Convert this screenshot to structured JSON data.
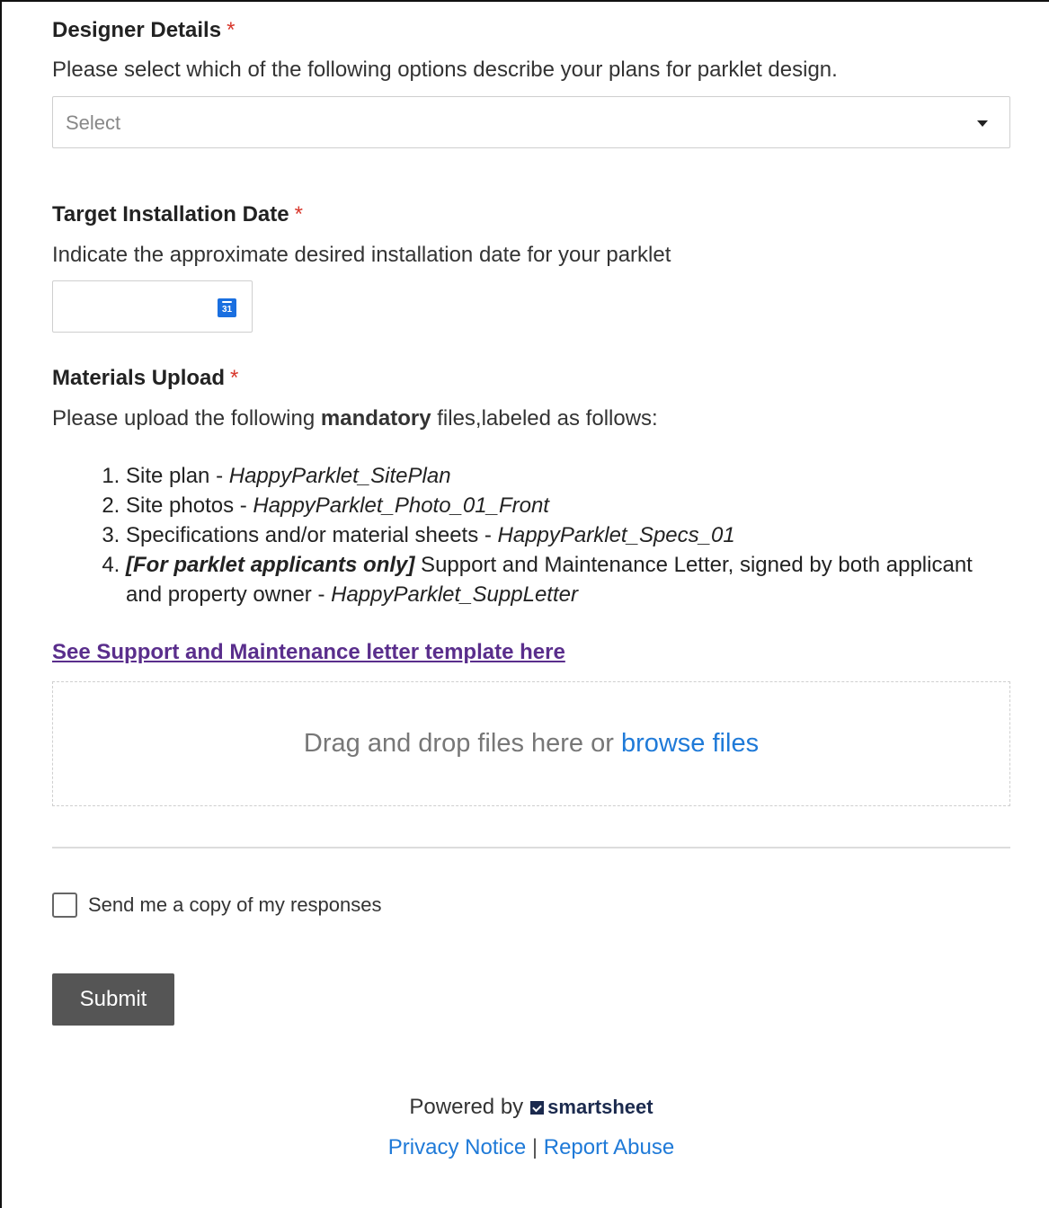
{
  "designer": {
    "label": "Designer Details",
    "required_mark": "*",
    "description": "Please select which of the following options describe your plans for parklet design.",
    "select_value": "Select"
  },
  "installation": {
    "label": "Target Installation Date",
    "required_mark": "*",
    "description": "Indicate the approximate desired installation date for your parklet",
    "date_value": "",
    "calendar_icon_text": "31"
  },
  "materials": {
    "label": "Materials Upload",
    "required_mark": "*",
    "desc_before": "Please upload the following ",
    "desc_bold": "mandatory",
    "desc_after": " files,labeled as follows:",
    "items": [
      {
        "text": "Site plan - ",
        "filename": "HappyParklet_SitePlan"
      },
      {
        "text": "Site photos - ",
        "filename": "HappyParklet_Photo_01_Front"
      },
      {
        "text": "Specifications and/or material sheets - ",
        "filename": "HappyParklet_Specs_01"
      },
      {
        "emph": "[For parklet applicants only]",
        "text": " Support and Maintenance Letter, signed by both applicant and property owner - ",
        "filename": "HappyParklet_SuppLetter"
      }
    ],
    "template_link": "See Support and Maintenance letter template here",
    "dropzone_text": "Drag and drop files here or ",
    "dropzone_link": "browse files"
  },
  "copy_checkbox": {
    "label": "Send me a copy of my responses",
    "checked": false
  },
  "submit_label": "Submit",
  "footer": {
    "powered_by": "Powered by",
    "brand": "smartsheet",
    "privacy": "Privacy Notice",
    "separator": "|",
    "report": "Report Abuse"
  },
  "colors": {
    "required": "#d8372c",
    "link": "#1f7ad8",
    "visited_link": "#5a2e8c",
    "submit_bg": "#555555"
  }
}
